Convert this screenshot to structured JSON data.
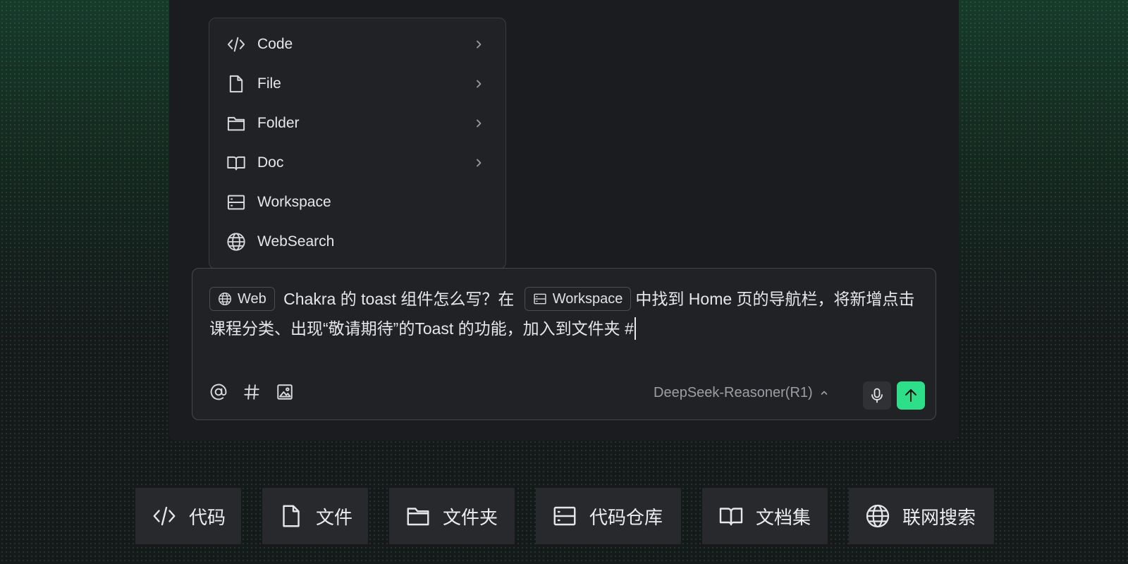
{
  "menu": {
    "items": [
      {
        "label": "Code",
        "icon": "code-icon",
        "has_submenu": true
      },
      {
        "label": "File",
        "icon": "file-icon",
        "has_submenu": true
      },
      {
        "label": "Folder",
        "icon": "folder-icon",
        "has_submenu": true
      },
      {
        "label": "Doc",
        "icon": "book-icon",
        "has_submenu": true
      },
      {
        "label": "Workspace",
        "icon": "workspace-icon",
        "has_submenu": false
      },
      {
        "label": "WebSearch",
        "icon": "globe-icon",
        "has_submenu": false
      }
    ]
  },
  "composer": {
    "chip_web": "Web",
    "text_1": "Chakra 的 toast 组件怎么写？在",
    "chip_workspace": "Workspace",
    "text_2": "中找到 Home 页的导航栏，将新增点击课程分类、出现“敬请期待”的Toast 的功能，加入到文件夹 #",
    "model": "DeepSeek-Reasoner(R1)",
    "tools": [
      "at-icon",
      "hash-icon",
      "image-icon"
    ]
  },
  "quick_actions": [
    {
      "label": "代码",
      "icon": "code-icon"
    },
    {
      "label": "文件",
      "icon": "file-icon"
    },
    {
      "label": "文件夹",
      "icon": "folder-icon"
    },
    {
      "label": "代码仓库",
      "icon": "workspace-icon"
    },
    {
      "label": "文档集",
      "icon": "book-icon"
    },
    {
      "label": "联网搜索",
      "icon": "globe-icon"
    }
  ],
  "colors": {
    "accent": "#2edf8a",
    "panel": "#1b1c1f",
    "surface": "#212225",
    "quick_action_bg": "#27292c"
  }
}
